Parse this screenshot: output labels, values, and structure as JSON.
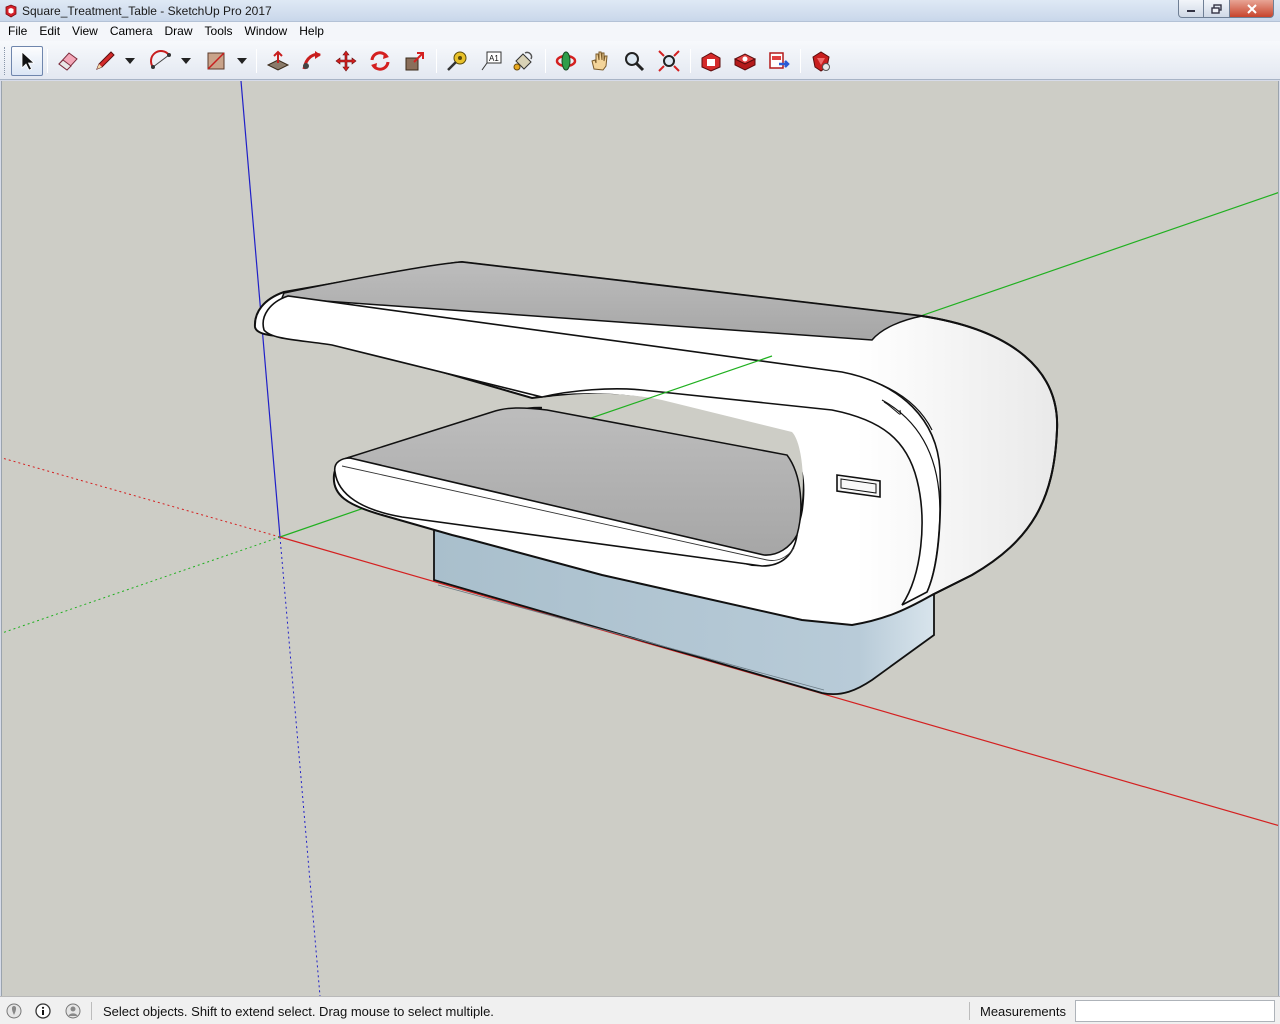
{
  "window": {
    "title": "Square_Treatment_Table - SketchUp Pro 2017",
    "app_icon": "sketchup-logo-icon",
    "buttons": [
      "minimize-icon",
      "maximize-icon",
      "close-icon"
    ]
  },
  "menubar": {
    "items": [
      "File",
      "Edit",
      "View",
      "Camera",
      "Draw",
      "Tools",
      "Window",
      "Help"
    ]
  },
  "toolbar": {
    "tools": [
      {
        "icon": "select-arrow-icon",
        "active": true
      },
      {
        "icon": "eraser-icon"
      },
      {
        "icon": "pencil-line-icon",
        "dropdown": true
      },
      {
        "icon": "arc-icon",
        "dropdown": true
      },
      {
        "icon": "rectangle-icon",
        "dropdown": true
      },
      {
        "icon": "push-pull-icon"
      },
      {
        "icon": "follow-me-icon"
      },
      {
        "icon": "move-icon"
      },
      {
        "icon": "rotate-icon"
      },
      {
        "icon": "scale-icon"
      },
      {
        "icon": "tape-measure-icon"
      },
      {
        "icon": "text-icon"
      },
      {
        "icon": "paint-bucket-icon"
      },
      {
        "icon": "orbit-icon"
      },
      {
        "icon": "pan-icon"
      },
      {
        "icon": "zoom-icon"
      },
      {
        "icon": "zoom-extents-icon"
      },
      {
        "icon": "3d-warehouse-icon"
      },
      {
        "icon": "extension-warehouse-icon"
      },
      {
        "icon": "send-to-layout-icon"
      },
      {
        "icon": "extension-manager-icon"
      }
    ]
  },
  "colors": {
    "viewport_bg": "#cdcdc6",
    "axis_red": "#d42020",
    "axis_green": "#20b020",
    "axis_blue": "#2020c8",
    "model_white": "#ffffff",
    "model_shadow": "#a8a8a8",
    "model_base": "#b0c4d2"
  },
  "statusbar": {
    "icons": [
      "geo-location-icon",
      "credits-icon",
      "user-account-icon"
    ],
    "message": "Select objects. Shift to extend select. Drag mouse to select multiple.",
    "measurements_label": "Measurements",
    "measurements_value": ""
  }
}
